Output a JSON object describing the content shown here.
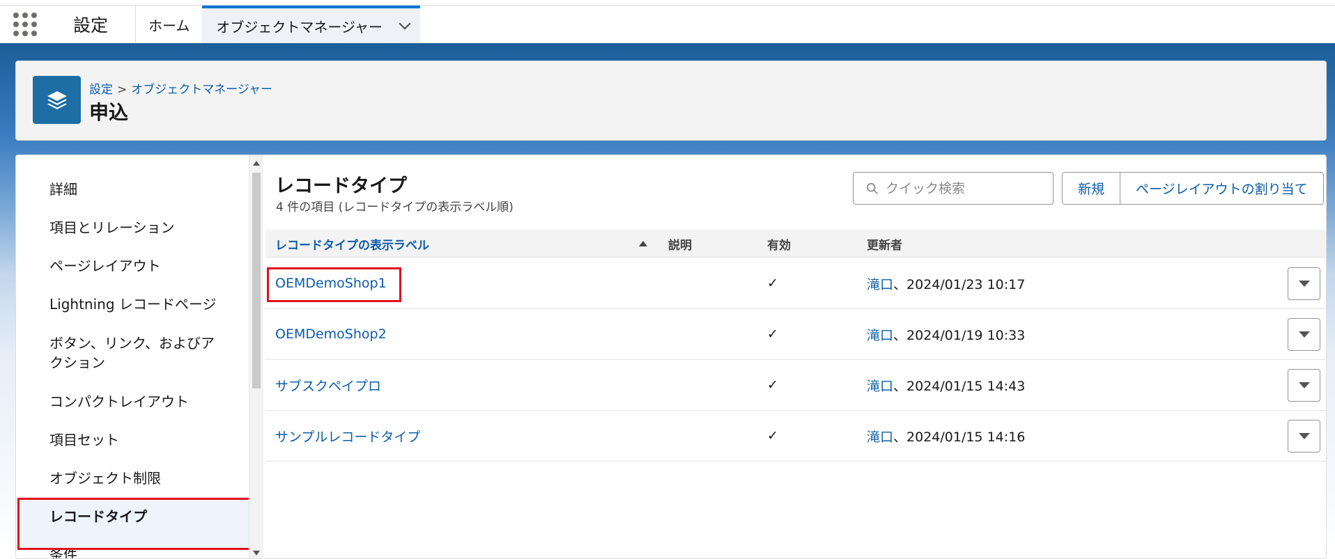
{
  "topbar": {
    "app_name": "設定",
    "tabs": [
      {
        "label": "ホーム"
      },
      {
        "label": "オブジェクトマネージャー"
      }
    ]
  },
  "header": {
    "breadcrumb_root": "設定",
    "breadcrumb_separator": ">",
    "breadcrumb_current": "オブジェクトマネージャー",
    "title": "申込"
  },
  "sidebar": {
    "items": [
      {
        "label": "詳細"
      },
      {
        "label": "項目とリレーション"
      },
      {
        "label": "ページレイアウト"
      },
      {
        "label": "Lightning レコードページ"
      },
      {
        "label": "ボタン、リンク、およびアクション"
      },
      {
        "label": "コンパクトレイアウト"
      },
      {
        "label": "項目セット"
      },
      {
        "label": "オブジェクト制限"
      },
      {
        "label": "レコードタイプ"
      },
      {
        "label": "条件"
      }
    ],
    "selected": "レコードタイプ"
  },
  "content": {
    "title": "レコードタイプ",
    "subtitle": "4 件の項目 (レコードタイプの表示ラベル順)",
    "search_placeholder": "クイック検索",
    "new_button": "新規",
    "assign_button": "ページレイアウトの割り当て",
    "columns": [
      "レコードタイプの表示ラベル",
      "説明",
      "有効",
      "更新者"
    ],
    "rows": [
      {
        "label": "OEMDemoShop1",
        "description": "",
        "active": "✓",
        "updated_by": "滝口",
        "updated_at": "、2024/01/23 10:17"
      },
      {
        "label": "OEMDemoShop2",
        "description": "",
        "active": "✓",
        "updated_by": "滝口",
        "updated_at": "、2024/01/19 10:33"
      },
      {
        "label": "サブスクペイプロ",
        "description": "",
        "active": "✓",
        "updated_by": "滝口",
        "updated_at": "、2024/01/15 14:43"
      },
      {
        "label": "サンプルレコードタイプ",
        "description": "",
        "active": "✓",
        "updated_by": "滝口",
        "updated_at": "、2024/01/15 14:16"
      }
    ]
  },
  "colors": {
    "brand_blue": "#0b5cab",
    "highlight_red": "#e0101f",
    "icon_bg": "#1e6ea6"
  },
  "icons": {
    "app_launcher": "app-launcher-icon",
    "object_icon": "layers-icon",
    "search": "search-icon",
    "row_menu": "dropdown-icon"
  }
}
